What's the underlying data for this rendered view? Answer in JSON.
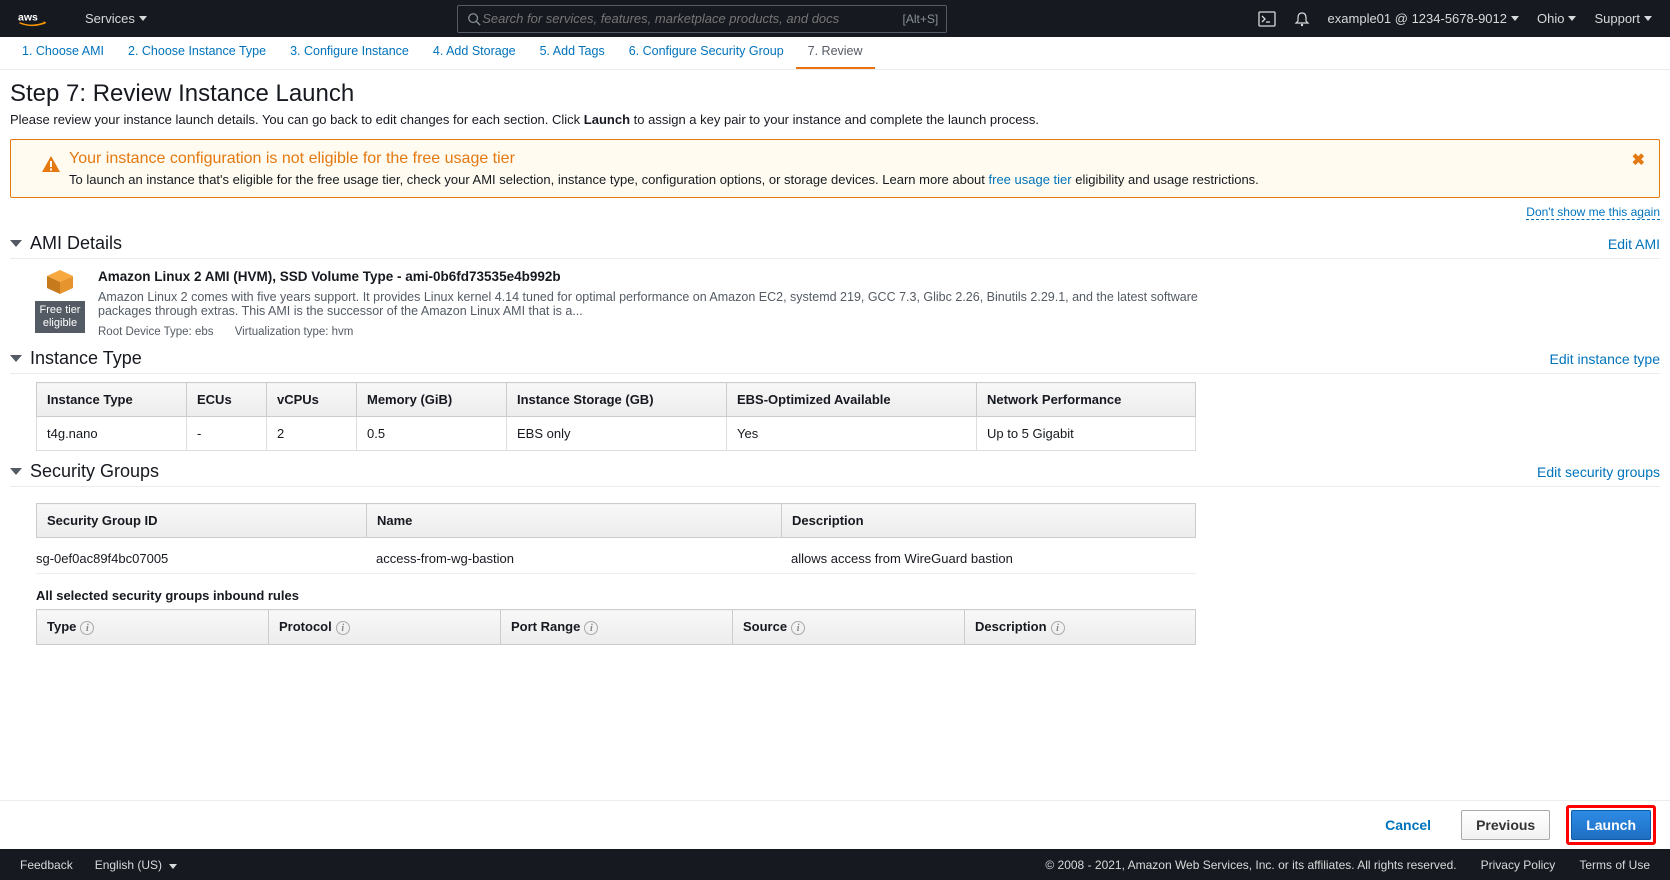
{
  "topbar": {
    "services_label": "Services",
    "search_placeholder": "Search for services, features, marketplace products, and docs",
    "search_hotkey": "[Alt+S]",
    "account": "example01 @ 1234-5678-9012",
    "region": "Ohio",
    "support": "Support"
  },
  "wizard_steps": [
    "1. Choose AMI",
    "2. Choose Instance Type",
    "3. Configure Instance",
    "4. Add Storage",
    "5. Add Tags",
    "6. Configure Security Group",
    "7. Review"
  ],
  "page": {
    "title": "Step 7: Review Instance Launch",
    "subtitle_pre": "Please review your instance launch details. You can go back to edit changes for each section. Click ",
    "subtitle_bold": "Launch",
    "subtitle_post": " to assign a key pair to your instance and complete the launch process."
  },
  "alert": {
    "title": "Your instance configuration is not eligible for the free usage tier",
    "msg_pre": "To launch an instance that's eligible for the free usage tier, check your AMI selection, instance type, configuration options, or storage devices. Learn more about ",
    "msg_link": "free usage tier",
    "msg_post": " eligibility and usage restrictions.",
    "dont_show": "Don't show me this again"
  },
  "ami": {
    "section_title": "AMI Details",
    "edit": "Edit AMI",
    "free_badge": "Free tier eligible",
    "title": "Amazon Linux 2 AMI (HVM), SSD Volume Type - ami-0b6fd73535e4b992b",
    "desc": "Amazon Linux 2 comes with five years support. It provides Linux kernel 4.14 tuned for optimal performance on Amazon EC2, systemd 219, GCC 7.3, Glibc 2.26, Binutils 2.29.1, and the latest software packages through extras. This AMI is the successor of the Amazon Linux AMI that is a...",
    "root_device": "Root Device Type: ebs",
    "virt": "Virtualization type: hvm"
  },
  "instance_type": {
    "section_title": "Instance Type",
    "edit": "Edit instance type",
    "headers": [
      "Instance Type",
      "ECUs",
      "vCPUs",
      "Memory (GiB)",
      "Instance Storage (GB)",
      "EBS-Optimized Available",
      "Network Performance"
    ],
    "row": [
      "t4g.nano",
      "-",
      "2",
      "0.5",
      "EBS only",
      "Yes",
      "Up to 5 Gigabit"
    ]
  },
  "sg": {
    "section_title": "Security Groups",
    "edit": "Edit security groups",
    "headers": [
      "Security Group ID",
      "Name",
      "Description"
    ],
    "row": [
      "sg-0ef0ac89f4bc07005",
      "access-from-wg-bastion",
      "allows access from WireGuard bastion"
    ],
    "inbound_title": "All selected security groups inbound rules",
    "rule_headers": [
      "Type",
      "Protocol",
      "Port Range",
      "Source",
      "Description"
    ]
  },
  "actions": {
    "cancel": "Cancel",
    "previous": "Previous",
    "launch": "Launch"
  },
  "footer": {
    "feedback": "Feedback",
    "lang": "English (US)",
    "copyright": "© 2008 - 2021, Amazon Web Services, Inc. or its affiliates. All rights reserved.",
    "privacy": "Privacy Policy",
    "terms": "Terms of Use"
  }
}
